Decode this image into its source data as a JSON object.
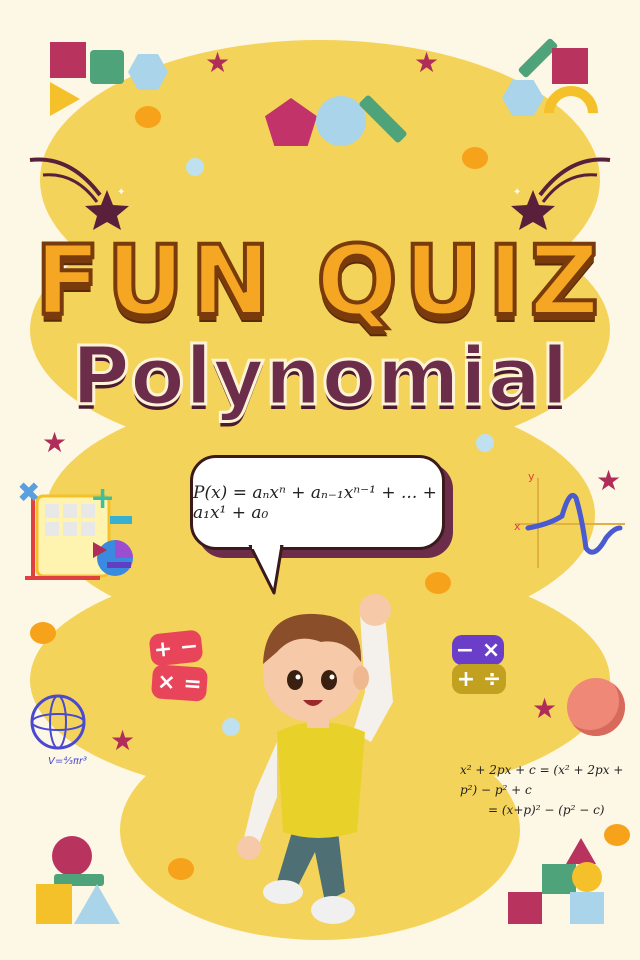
{
  "title": {
    "line1": "FUN QUIZ",
    "line2": "Polynomial"
  },
  "speech_bubble": {
    "formula": "P(x) = aₙxⁿ + aₙ₋₁xⁿ⁻¹ + ... + a₁x¹ + a₀"
  },
  "side_equation": {
    "line1": "x² + 2px + c = (x² + 2px + p²) − p² + c",
    "line2": "= (x+p)² − (p² − c)"
  },
  "graph_labels": {
    "y_axis": "y",
    "x_axis": "x"
  },
  "sphere_label": "V=⁴⁄₃πr³",
  "icons": [
    "calculator-icon",
    "math-operators-icon",
    "star-icon",
    "sphere-icon",
    "function-graph-icon",
    "geometric-shapes-icon"
  ],
  "colors": {
    "background": "#fdf7e6",
    "blob": "#f4d35a",
    "title_orange": "#f5a623",
    "title_purple": "#6b2d4a",
    "star": "#b02d5a"
  }
}
